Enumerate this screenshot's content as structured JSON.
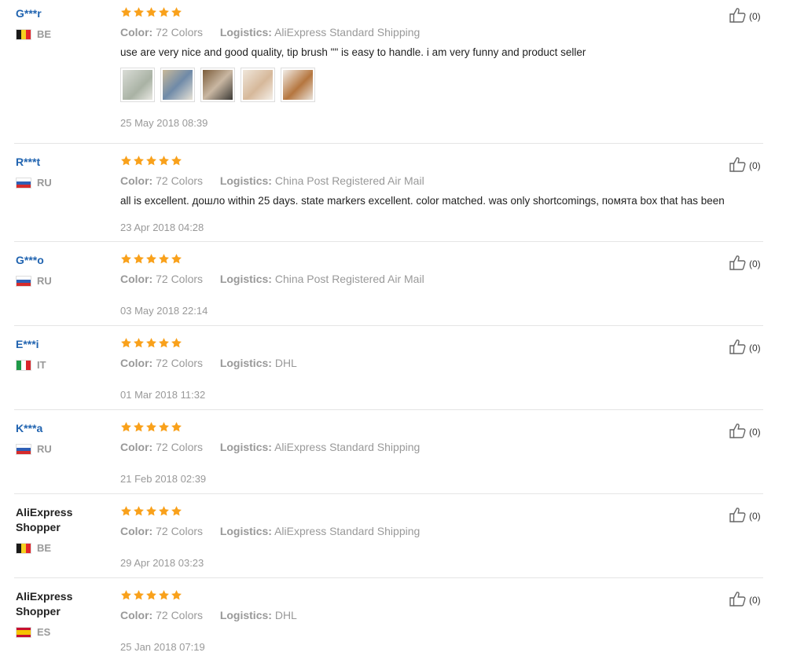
{
  "colors": {
    "accent": "#2164b0",
    "star": "#f9a11b",
    "muted": "#999999"
  },
  "labels": {
    "color": "Color:",
    "logistics": "Logistics:"
  },
  "reviews": [
    {
      "user": "G***r",
      "country": "BE",
      "rating": 5,
      "color": "72 Colors",
      "logistics": "AliExpress Standard Shipping",
      "text": "use are very nice and good quality, tip brush \"\" is easy to handle. i am very funny and product seller",
      "photos": 5,
      "date": "25 May 2018 08:39",
      "likes": "(0)"
    },
    {
      "user": "R***t",
      "country": "RU",
      "rating": 5,
      "color": "72 Colors",
      "logistics": "China Post Registered Air Mail",
      "text": "all is excellent. дошло within 25 days. state markers excellent. color matched. was only shortcomings, помята box that has been",
      "photos": 0,
      "date": "23 Apr 2018 04:28",
      "likes": "(0)"
    },
    {
      "user": "G***o",
      "country": "RU",
      "rating": 5,
      "color": "72 Colors",
      "logistics": "China Post Registered Air Mail",
      "text": "",
      "photos": 0,
      "date": "03 May 2018 22:14",
      "likes": "(0)"
    },
    {
      "user": "E***i",
      "country": "IT",
      "rating": 5,
      "color": "72 Colors",
      "logistics": "DHL",
      "text": "",
      "photos": 0,
      "date": "01 Mar 2018 11:32",
      "likes": "(0)"
    },
    {
      "user": "K***a",
      "country": "RU",
      "rating": 5,
      "color": "72 Colors",
      "logistics": "AliExpress Standard Shipping",
      "text": "",
      "photos": 0,
      "date": "21 Feb 2018 02:39",
      "likes": "(0)"
    },
    {
      "user": "AliExpress Shopper",
      "country": "BE",
      "rating": 5,
      "color": "72 Colors",
      "logistics": "AliExpress Standard Shipping",
      "text": "",
      "photos": 0,
      "date": "29 Apr 2018 03:23",
      "likes": "(0)"
    },
    {
      "user": "AliExpress Shopper",
      "country": "ES",
      "rating": 5,
      "color": "72 Colors",
      "logistics": "DHL",
      "text": "",
      "photos": 0,
      "date": "25 Jan 2018 07:19",
      "likes": "(0)"
    }
  ]
}
